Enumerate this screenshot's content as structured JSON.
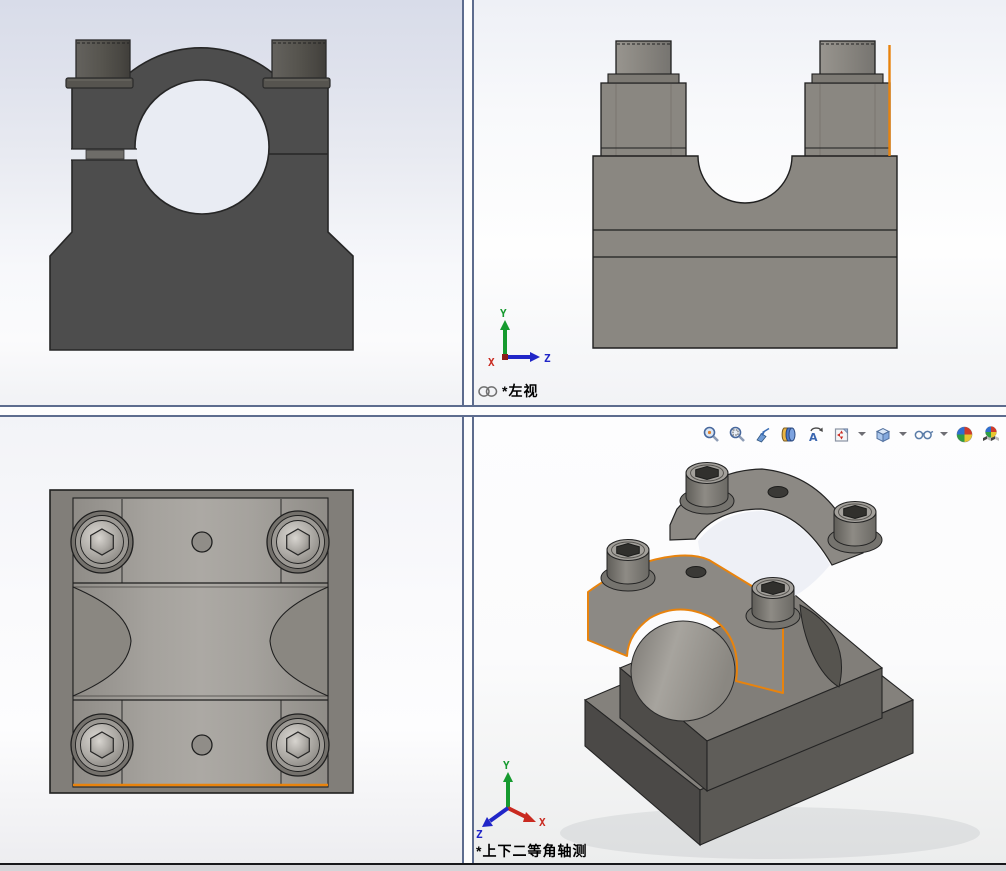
{
  "workspace": {
    "layout": "four-viewport",
    "selection_color": "#E8830D",
    "part_color_dark": "#4D4D4D",
    "part_color_light": "#8A8781"
  },
  "viewports": {
    "top_right": {
      "label": "*左视",
      "linked_icon": "chain-link-icon",
      "triad": {
        "x": {
          "label": "X",
          "color": "#C92A20"
        },
        "y": {
          "label": "Y",
          "color": "#169A2F"
        },
        "z": {
          "label": "Z",
          "color": "#2126C8"
        }
      }
    },
    "bottom_right": {
      "label": "*上下二等角轴测",
      "triad": {
        "x": {
          "label": "X",
          "color": "#C92A20"
        },
        "y": {
          "label": "Y",
          "color": "#169A2F"
        },
        "z": {
          "label": "Z",
          "color": "#2126C8"
        }
      },
      "toolbar": {
        "icons": [
          {
            "name": "zoom-to-fit-icon"
          },
          {
            "name": "zoom-to-area-icon"
          },
          {
            "name": "previous-view-icon"
          },
          {
            "name": "section-view-icon"
          },
          {
            "name": "3d-drawing-view-icon"
          },
          {
            "name": "view-orientation-icon",
            "has_dropdown": true
          },
          {
            "name": "display-style-icon",
            "has_dropdown": true
          },
          {
            "name": "hide-show-items-icon",
            "has_dropdown": true
          },
          {
            "name": "edit-appearance-icon"
          },
          {
            "name": "apply-scene-icon"
          }
        ]
      }
    }
  }
}
